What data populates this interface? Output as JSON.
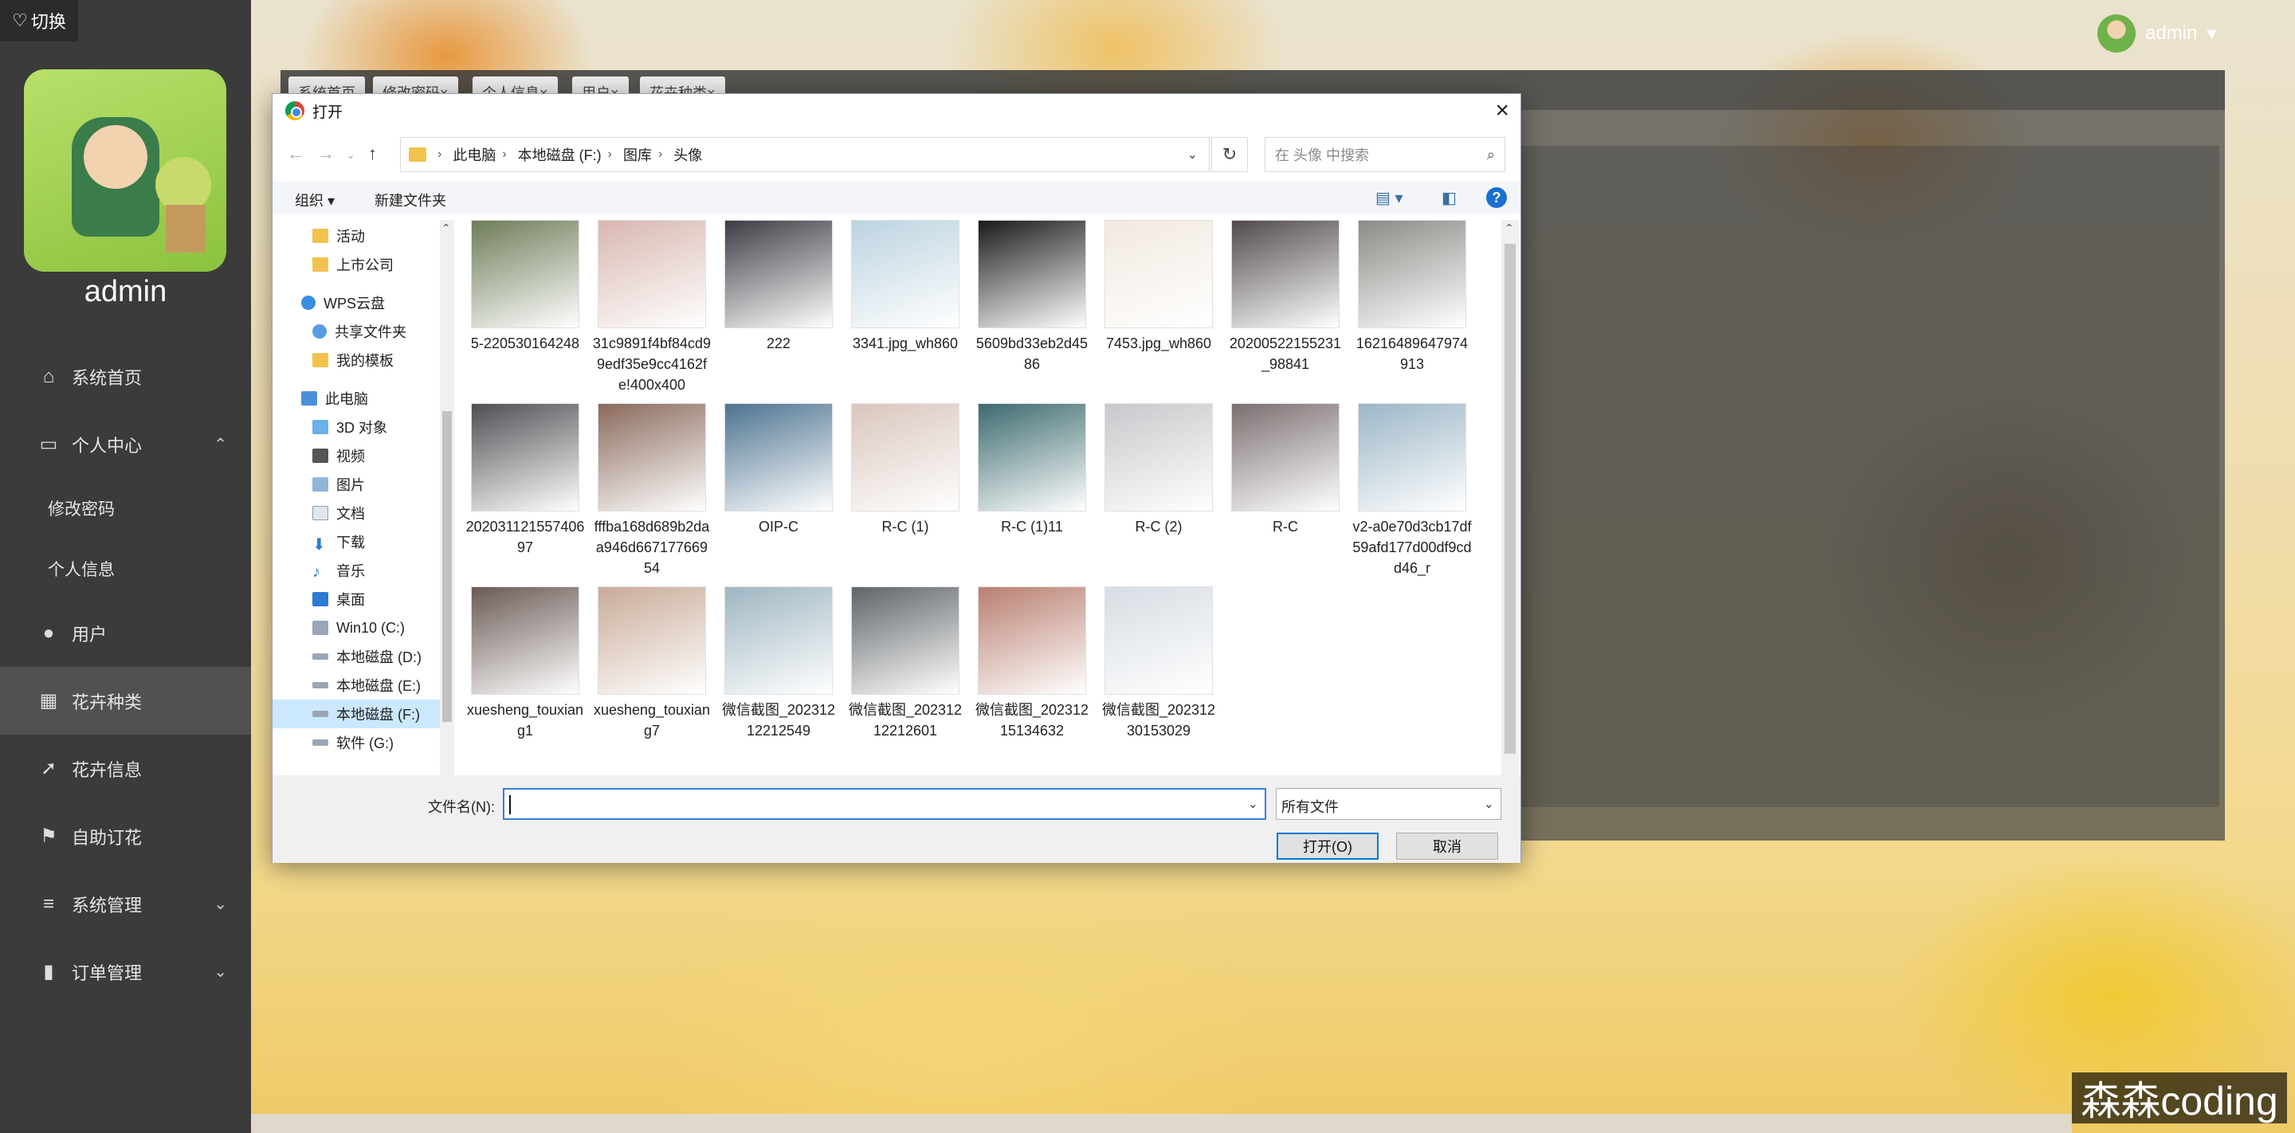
{
  "sidebar": {
    "switch_label": "切换",
    "admin_name": "admin",
    "items": [
      {
        "label": "系统首页",
        "icon": "home-icon"
      },
      {
        "label": "个人中心",
        "icon": "folder-icon"
      },
      {
        "label": "修改密码"
      },
      {
        "label": "个人信息"
      },
      {
        "label": "用户",
        "icon": "bulb-icon"
      },
      {
        "label": "花卉种类",
        "icon": "grid-icon"
      },
      {
        "label": "花卉信息",
        "icon": "rocket-icon"
      },
      {
        "label": "自助订花",
        "icon": "flag-icon"
      },
      {
        "label": "系统管理",
        "icon": "list-icon"
      },
      {
        "label": "订单管理",
        "icon": "bar-chart-icon"
      }
    ]
  },
  "header": {
    "user": "admin",
    "tabs": [
      "系统首页",
      "修改密码×",
      "个人信息×",
      "用户×",
      "花卉种类×"
    ]
  },
  "dialog": {
    "title": "打开",
    "breadcrumb": [
      "此电脑",
      "本地磁盘 (F:)",
      "图库",
      "头像"
    ],
    "search_placeholder": "在 头像 中搜索",
    "toolbar": {
      "organize": "组织 ▾",
      "new_folder": "新建文件夹"
    },
    "tree": [
      {
        "label": "活动",
        "icon": "folder-icon"
      },
      {
        "label": "上市公司",
        "icon": "folder-icon"
      },
      {
        "label": "WPS云盘",
        "icon": "cloud-icon"
      },
      {
        "label": "共享文件夹",
        "icon": "share-icon"
      },
      {
        "label": "我的模板",
        "icon": "folder-icon"
      },
      {
        "label": "此电脑",
        "icon": "computer-icon"
      },
      {
        "label": "3D 对象",
        "icon": "cube-icon"
      },
      {
        "label": "视频",
        "icon": "video-icon"
      },
      {
        "label": "图片",
        "icon": "picture-icon"
      },
      {
        "label": "文档",
        "icon": "document-icon"
      },
      {
        "label": "下载",
        "icon": "download-icon"
      },
      {
        "label": "音乐",
        "icon": "music-icon"
      },
      {
        "label": "桌面",
        "icon": "desktop-icon"
      },
      {
        "label": "Win10 (C:)",
        "icon": "drive-icon"
      },
      {
        "label": "本地磁盘 (D:)",
        "icon": "drive-icon"
      },
      {
        "label": "本地磁盘 (E:)",
        "icon": "drive-icon"
      },
      {
        "label": "本地磁盘 (F:)",
        "icon": "drive-icon"
      },
      {
        "label": "软件 (G:)",
        "icon": "drive-icon"
      }
    ],
    "files": [
      {
        "name": "5-220530164248",
        "color": "#6e7c58"
      },
      {
        "name": "31c9891f4bf84cd99edf35e9cc4162fe!400x400",
        "color": "#d8b7b0"
      },
      {
        "name": "222",
        "color": "#3c3c44"
      },
      {
        "name": "3341.jpg_wh860",
        "color": "#bcd3e0"
      },
      {
        "name": "5609bd33eb2d4586",
        "color": "#1a1a1a"
      },
      {
        "name": "7453.jpg_wh860",
        "color": "#f1e9df"
      },
      {
        "name": "20200522155231_98841",
        "color": "#514a4c"
      },
      {
        "name": "16216489647974913",
        "color": "#8c8a86"
      },
      {
        "name": "20203112155740697",
        "color": "#4f4f54"
      },
      {
        "name": "fffba168d689b2daa946d66717766954",
        "color": "#8a6a5c"
      },
      {
        "name": "OIP-C",
        "color": "#4d7390"
      },
      {
        "name": "R-C (1)",
        "color": "#d9c6bd"
      },
      {
        "name": "R-C (1)11",
        "color": "#3c6a6f"
      },
      {
        "name": "R-C (2)",
        "color": "#c8c8cc"
      },
      {
        "name": "R-C",
        "color": "#7b6f70"
      },
      {
        "name": "v2-a0e70d3cb17df59afd177d00df9cdd46_r",
        "color": "#9cb6c7"
      },
      {
        "name": "xuesheng_touxiang1",
        "color": "#6a5a55"
      },
      {
        "name": "xuesheng_touxiang7",
        "color": "#c9ab98"
      },
      {
        "name": "微信截图_20231212212549",
        "color": "#9fb6c2"
      },
      {
        "name": "微信截图_20231212212601",
        "color": "#5f6468"
      },
      {
        "name": "微信截图_20231215134632",
        "color": "#b97f70"
      },
      {
        "name": "微信截图_20231230153029",
        "color": "#d7dde4"
      }
    ],
    "filename_label": "文件名(N):",
    "filename_value": "",
    "filetype": "所有文件",
    "open_button": "打开(O)",
    "cancel_button": "取消"
  },
  "watermark": "森森coding"
}
